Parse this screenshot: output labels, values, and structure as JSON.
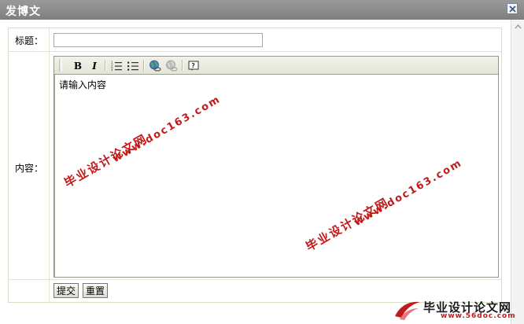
{
  "window": {
    "title": "发博文",
    "close_icon": "close-icon"
  },
  "form": {
    "title_label": "标题：",
    "title_value": "",
    "content_label": "内容：",
    "content_placeholder": "请输入内容",
    "submit_label": "提交",
    "reset_label": "重置"
  },
  "toolbar": {
    "bold_label": "B",
    "italic_label": "I",
    "buttons": [
      "bold-icon",
      "italic-icon",
      "ordered-list-icon",
      "unordered-list-icon",
      "insert-link-icon",
      "remove-link-icon",
      "help-icon"
    ]
  },
  "watermarks": {
    "cn_text": "毕业设计论文网",
    "url_text": "www.doc163.com"
  },
  "logo": {
    "cn_text": "毕业设计论文网",
    "url_text": "www.56doc.com"
  },
  "colors": {
    "titlebar": "#8c8c8c",
    "watermark": "#c21a1a",
    "table_border": "#d7dfc9"
  }
}
